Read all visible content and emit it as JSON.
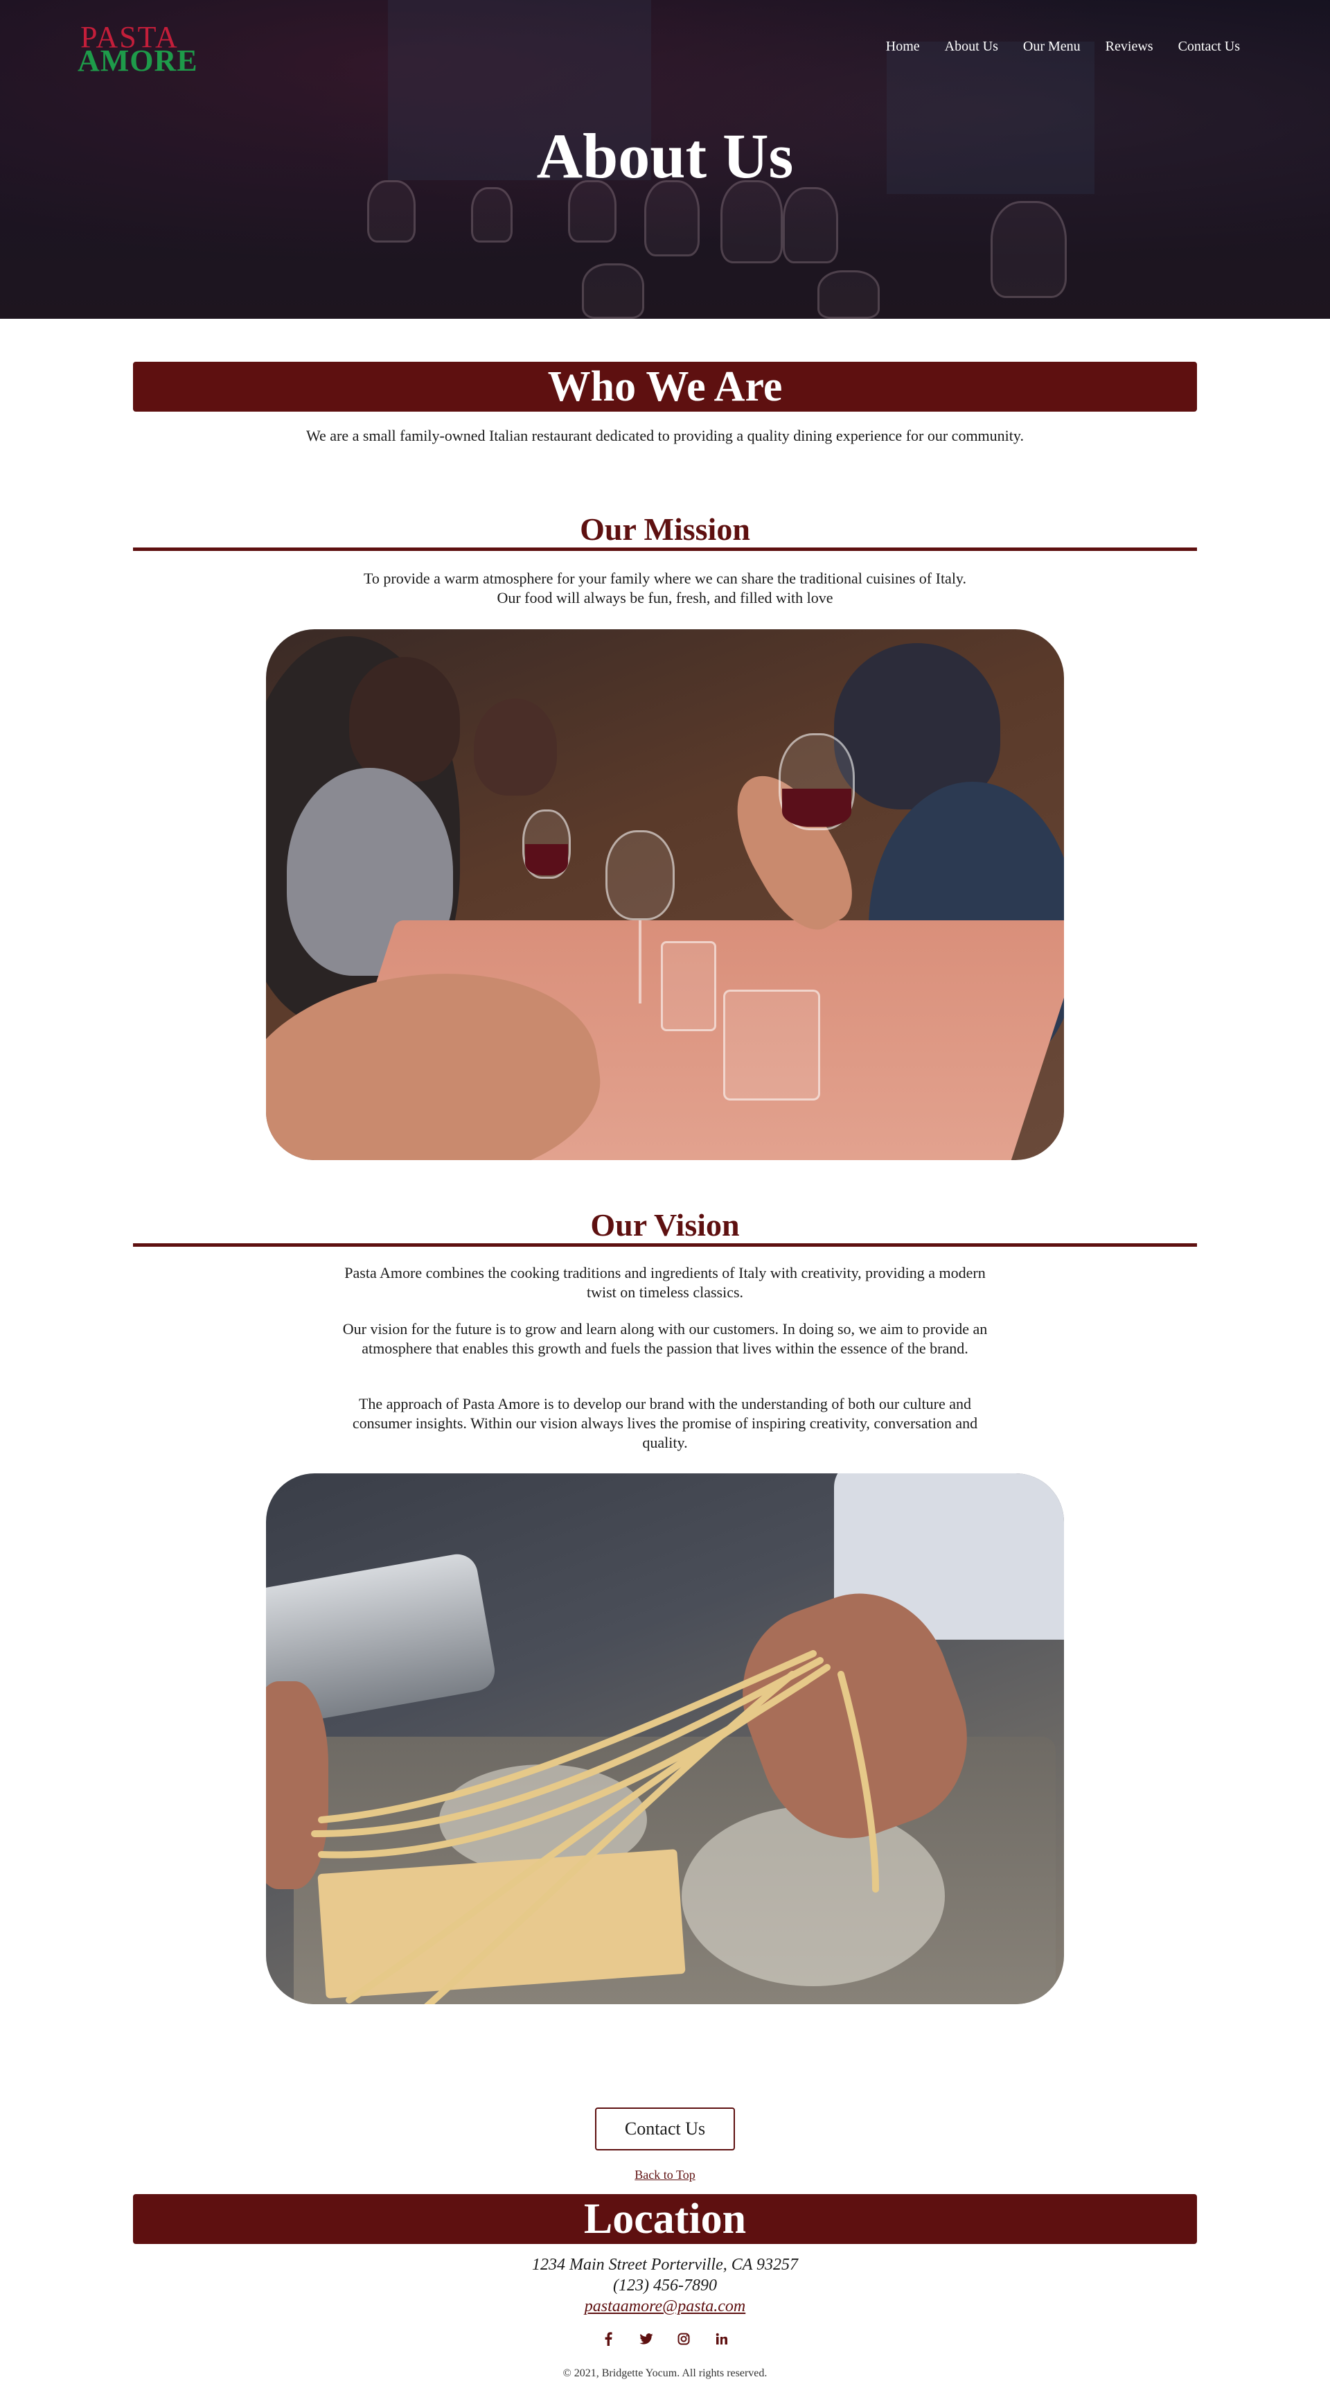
{
  "brand": {
    "logo_top": "PASTA",
    "logo_bottom": "AMORE",
    "logo_top_color": "#c41e3a",
    "logo_bottom_color": "#1e9b4a"
  },
  "nav": {
    "items": [
      "Home",
      "About Us",
      "Our Menu",
      "Reviews",
      "Contact Us"
    ]
  },
  "hero": {
    "title": "About Us"
  },
  "who_we_are": {
    "title": "Who We Are",
    "text": "We are a small family-owned Italian restaurant dedicated to providing a quality dining experience for our community."
  },
  "mission": {
    "title": "Our Mission",
    "line1": "To provide a warm atmosphere for your family where we can share the traditional cuisines of Italy.",
    "line2": "Our food will always be fun, fresh, and filled with love"
  },
  "vision": {
    "title": "Our Vision",
    "p1": "Pasta Amore combines the cooking traditions and ingredients of Italy with creativity, providing a modern twist on timeless classics.",
    "p2": "Our vision for the future is to grow and learn along with our customers. In doing so, we aim to provide an atmosphere that enables this growth and fuels the passion that lives within the essence of the brand.",
    "p3": "The approach of Pasta Amore is to develop our brand with the understanding of both our culture and consumer insights. Within our vision always lives the promise of inspiring creativity, conversation and quality."
  },
  "actions": {
    "contact_button": "Contact Us",
    "back_to_top": "Back to Top"
  },
  "location": {
    "title": "Location",
    "address": "1234 Main Street Porterville, CA 93257",
    "phone": "(123) 456-7890",
    "email": "pastaamore@pasta.com"
  },
  "social": {
    "icons": [
      "facebook-icon",
      "twitter-icon",
      "instagram-icon",
      "linkedin-icon"
    ]
  },
  "footer": {
    "copyright": "© 2021, Bridgette Yocum. All rights reserved."
  },
  "colors": {
    "accent": "#5e1010"
  }
}
